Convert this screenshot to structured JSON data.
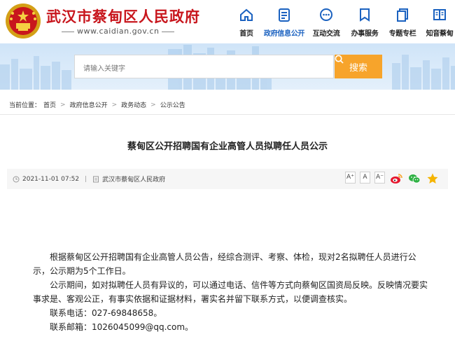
{
  "header": {
    "site_title": "武汉市蔡甸区人民政府",
    "site_url": "www.caidian.gov.cn",
    "brand_color": "#c8161d",
    "nav": [
      {
        "label": "首页",
        "icon": "home-icon"
      },
      {
        "label": "政府信息公开",
        "icon": "document-list-icon",
        "active": true
      },
      {
        "label": "互动交流",
        "icon": "chat-bubble-icon"
      },
      {
        "label": "办事服务",
        "icon": "bookmark-icon"
      },
      {
        "label": "专题专栏",
        "icon": "copy-pages-icon"
      },
      {
        "label": "知音蔡甸",
        "icon": "book-icon"
      }
    ]
  },
  "search": {
    "placeholder": "请输入关键字",
    "button_label": "搜索",
    "button_color": "#f7a42b"
  },
  "breadcrumb": {
    "label": "当前位置：",
    "items": [
      "首页",
      "政府信息公开",
      "政务动态",
      "公示公告"
    ]
  },
  "article": {
    "title": "蔡甸区公开招聘国有企业高管人员拟聘任人员公示",
    "date": "2021-11-01 07:52",
    "source": "武汉市蔡甸区人民政府",
    "font_sizes": [
      "A⁺",
      "A",
      "A⁻"
    ],
    "paragraphs": [
      "根据蔡甸区公开招聘国有企业高管人员公告，经综合测评、考察、体检，现对2名拟聘任人员进行公示，公示期为5个工作日。",
      "公示期间，如对拟聘任人员有异议的，可以通过电话、信件等方式向蔡甸区国资局反映。反映情况要实事求是、客观公正，有事实依据和证据材料，署实名并留下联系方式，以便调查核实。",
      "联系电话：027-69848658。",
      "联系邮箱：1026045099@qq.com。"
    ]
  },
  "share_icons": [
    "weibo-icon",
    "wechat-icon",
    "favorite-star-icon"
  ]
}
